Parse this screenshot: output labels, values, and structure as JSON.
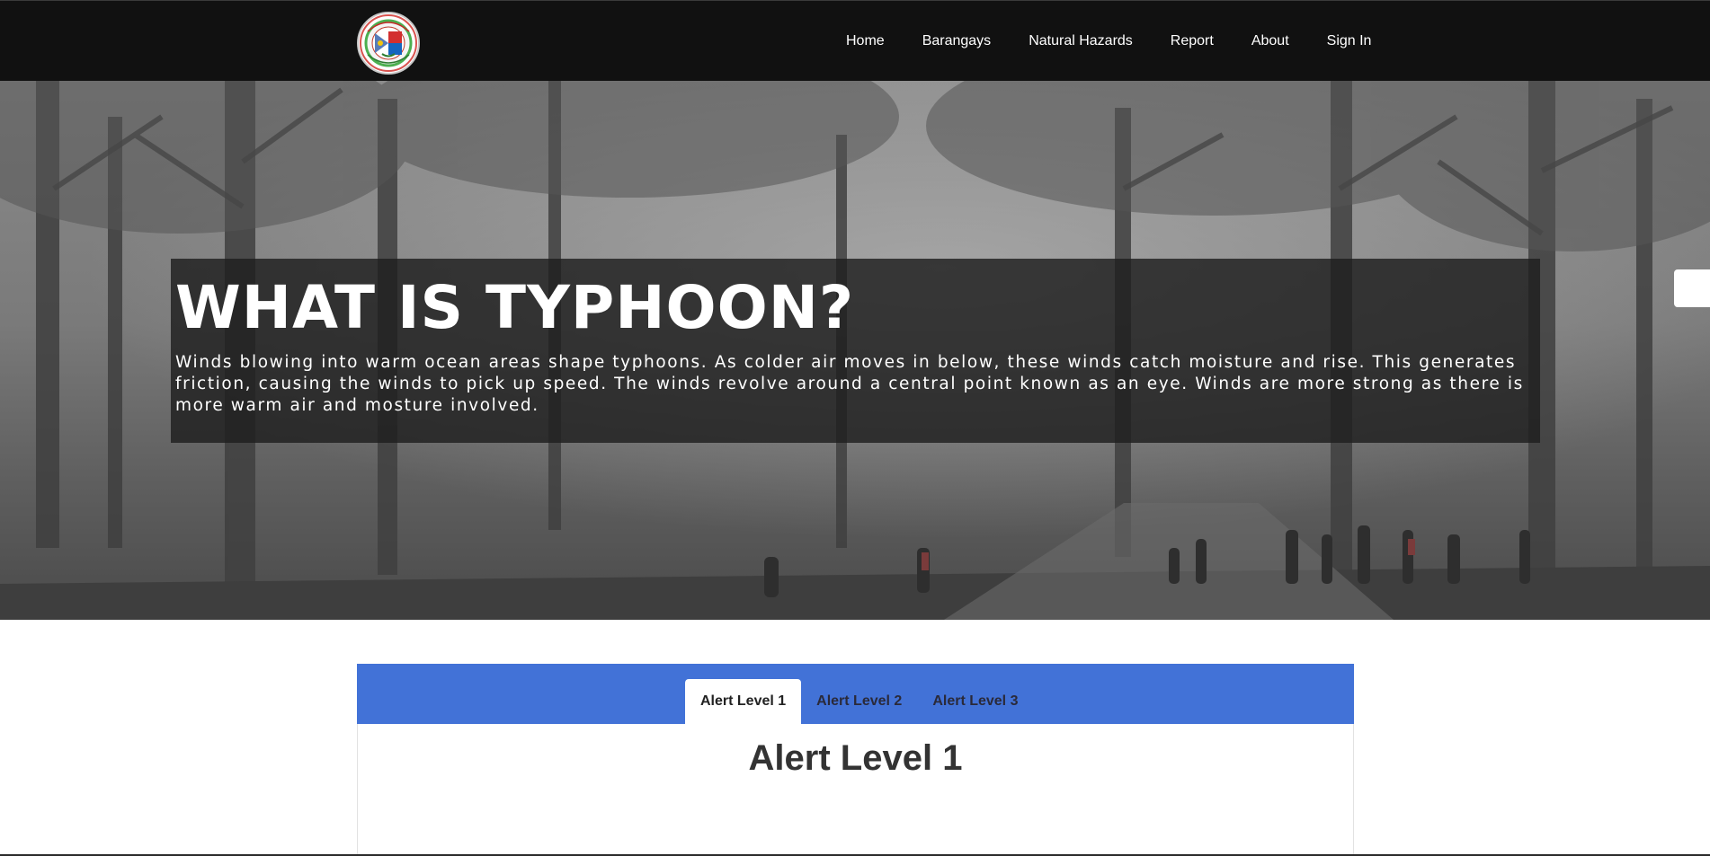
{
  "nav": {
    "items": [
      {
        "label": "Home"
      },
      {
        "label": "Barangays"
      },
      {
        "label": "Natural Hazards"
      },
      {
        "label": "Report"
      },
      {
        "label": "About"
      },
      {
        "label": "Sign In"
      }
    ]
  },
  "hero": {
    "title": "WHAT IS TYPHOON?",
    "text": "Winds blowing into warm ocean areas shape typhoons. As colder air moves in below, these winds catch moisture and rise. This generates friction, causing the winds to pick up speed. The winds revolve around a central point known as an eye. Winds are more strong as there is more warm air and mosture involved."
  },
  "alerts": {
    "tabs": [
      {
        "label": "Alert Level 1",
        "active": true
      },
      {
        "label": "Alert Level 2",
        "active": false
      },
      {
        "label": "Alert Level 3",
        "active": false
      }
    ],
    "panel_title": "Alert Level 1"
  },
  "colors": {
    "navbar": "#111111",
    "tabs_bar": "#4272d7",
    "hero_overlay": "#1e1e1e"
  }
}
